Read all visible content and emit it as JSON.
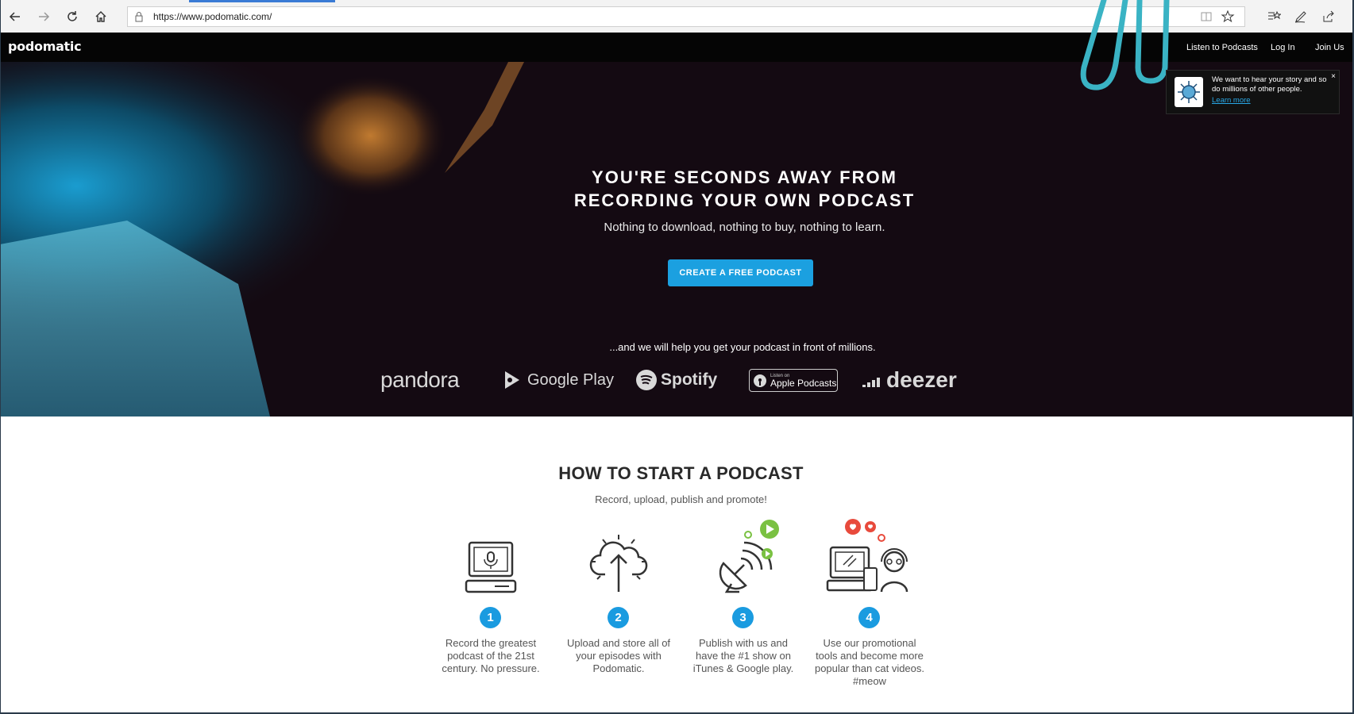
{
  "browser": {
    "url": "https://www.podomatic.com/",
    "icons": [
      "back-icon",
      "forward-icon",
      "refresh-icon",
      "home-icon",
      "lock-icon",
      "reader-view-icon",
      "favorite-star-icon",
      "favorites-hub-icon",
      "pen-icon",
      "share-icon"
    ]
  },
  "site": {
    "logo": "podomatic",
    "nav": {
      "listen": "Listen to Podcasts",
      "login": "Log In",
      "join": "Join Us"
    }
  },
  "hero": {
    "title_line1": "YOU'RE SECONDS AWAY FROM",
    "title_line2": "RECORDING YOUR OWN PODCAST",
    "subtitle": "Nothing to download, nothing to buy, nothing to learn.",
    "cta": "CREATE A FREE PODCAST",
    "help": "...and we will help you get your podcast in front of millions.",
    "platforms": {
      "pandora": "pandora",
      "google": "Google Play",
      "spotify": "Spotify",
      "apple_small": "Listen on",
      "apple": "Apple Podcasts",
      "deezer": "deezer"
    }
  },
  "notification": {
    "text": "We want to hear your story and so do millions of other people.",
    "link": "Learn more",
    "close": "×"
  },
  "howto": {
    "title": "HOW TO START A PODCAST",
    "subtitle": "Record, upload, publish and promote!",
    "steps": [
      {
        "num": "1",
        "text": "Record the greatest podcast of the 21st century. No pressure."
      },
      {
        "num": "2",
        "text": "Upload and store all of your episodes with Podomatic."
      },
      {
        "num": "3",
        "text": "Publish with us and have the #1 show on iTunes & Google play."
      },
      {
        "num": "4",
        "text": "Use our promotional tools and become more popular than cat videos. #meow"
      }
    ]
  },
  "colors": {
    "accent": "#1ba0e0",
    "nav_bg": "#050505",
    "hero_bg": "#140a12",
    "squiggle": "#3ab3c4",
    "icon_green": "#7ac142",
    "icon_red": "#e84a3c"
  }
}
